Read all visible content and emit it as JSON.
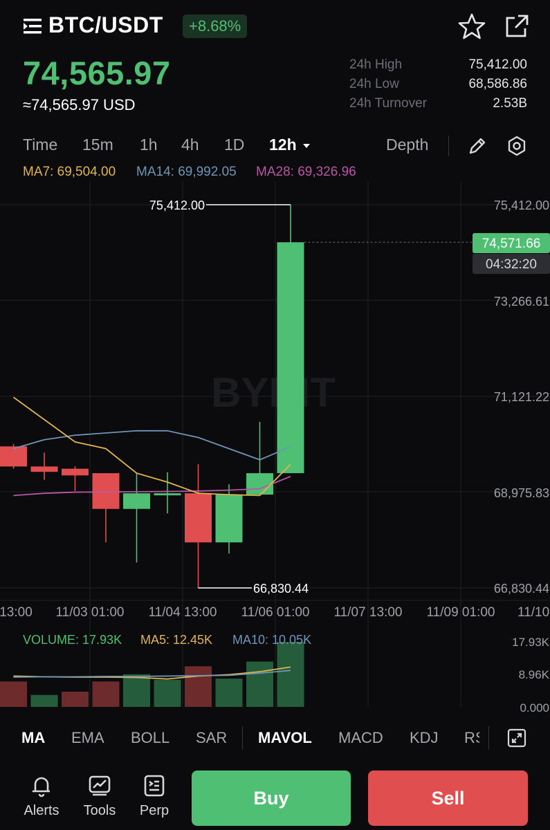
{
  "header": {
    "pair": "BTC/USDT",
    "change_pct": "+8.68%",
    "last_price": "74,565.97",
    "fiat_price": "≈74,565.97 USD"
  },
  "stats": [
    {
      "label": "24h High",
      "value": "75,412.00"
    },
    {
      "label": "24h Low",
      "value": "68,586.86"
    },
    {
      "label": "24h Turnover",
      "value": "2.53B"
    }
  ],
  "timeframes": [
    "Time",
    "15m",
    "1h",
    "4h",
    "1D",
    "12h"
  ],
  "selected_timeframe": "12h",
  "depth_label": "Depth",
  "moving_averages": {
    "ma7": "MA7: 69,504.00",
    "ma14": "MA14: 69,992.05",
    "ma28": "MA28: 69,326.96"
  },
  "colors": {
    "up": "#4fbf73",
    "down": "#e04e4f",
    "ma7": "#e2b54c",
    "ma14": "#6f95b8",
    "ma28": "#b957a5"
  },
  "watermark": "BYBIT",
  "chart_data": {
    "type": "candlestick",
    "y_axis_labels": [
      "75,412.00",
      "73,266.61",
      "71,121.22",
      "68,975.83",
      "66,830.44"
    ],
    "ylim": [
      66830.44,
      75412.0
    ],
    "x_axis_labels": [
      "13:00",
      "11/03 01:00",
      "11/04 13:00",
      "11/06 01:00",
      "11/07 13:00",
      "11/09 01:00",
      "11/10"
    ],
    "high_marker": "75,412.00",
    "low_marker": "66,830.44",
    "current_price_tag": "74,571.66",
    "countdown": "04:32:20",
    "candles": [
      {
        "open": 70000,
        "close": 69550,
        "high": 70050,
        "low": 69500
      },
      {
        "open": 69550,
        "close": 69430,
        "high": 69860,
        "low": 69250
      },
      {
        "open": 69500,
        "close": 69350,
        "high": 69550,
        "low": 69000
      },
      {
        "open": 69400,
        "close": 68600,
        "high": 69400,
        "low": 67850
      },
      {
        "open": 68600,
        "close": 68950,
        "high": 69400,
        "low": 67400
      },
      {
        "open": 68950,
        "close": 68950,
        "high": 69420,
        "low": 68500
      },
      {
        "open": 68950,
        "close": 67850,
        "high": 69600,
        "low": 66830.44
      },
      {
        "open": 67850,
        "close": 68920,
        "high": 69150,
        "low": 67600
      },
      {
        "open": 68920,
        "close": 69400,
        "high": 70550,
        "low": 68920
      },
      {
        "open": 69400,
        "close": 74571.66,
        "high": 75412.0,
        "low": 69400
      }
    ],
    "ma7_series": [
      71100,
      70600,
      70100,
      69950,
      69400,
      69200,
      68950,
      68920,
      68900,
      69600
    ],
    "ma14_series": [
      69950,
      70150,
      70250,
      70300,
      70350,
      70350,
      70200,
      69950,
      69700,
      69992.05
    ],
    "ma28_series": [
      68900,
      68950,
      68975,
      68980,
      68985,
      68990,
      69000,
      69020,
      69050,
      69326.96
    ],
    "volume": {
      "label": "VOLUME: 17.93K",
      "ma5_label": "MA5: 12.45K",
      "ma10_label": "MA10: 10.05K",
      "y_axis_labels": [
        "17.93K",
        "8.96K",
        "0.000"
      ],
      "ylim": [
        0,
        17.93
      ],
      "values_k": [
        7.0,
        3.3,
        4.2,
        7.0,
        9.0,
        7.5,
        11.2,
        7.8,
        12.5,
        17.93
      ],
      "up": [
        false,
        true,
        false,
        false,
        true,
        true,
        false,
        true,
        true,
        true
      ],
      "ma5_k": [
        8.5,
        8.3,
        8.2,
        8.2,
        8.1,
        7.7,
        8.5,
        8.9,
        9.7,
        11.0
      ],
      "ma10_k": [
        8.2,
        8.3,
        8.3,
        8.4,
        8.4,
        8.5,
        8.6,
        8.7,
        9.3,
        10.05
      ]
    }
  },
  "indicators": [
    "MA",
    "EMA",
    "BOLL",
    "SAR",
    "MAVOL",
    "MACD",
    "KDJ",
    "RSI"
  ],
  "active_indicators": [
    "MA",
    "MAVOL"
  ],
  "bottom_nav": [
    {
      "label": "Alerts",
      "icon": "bell-icon"
    },
    {
      "label": "Tools",
      "icon": "chart-tools-icon"
    },
    {
      "label": "Perp",
      "icon": "perp-doc-icon"
    }
  ],
  "buy_label": "Buy",
  "sell_label": "Sell"
}
